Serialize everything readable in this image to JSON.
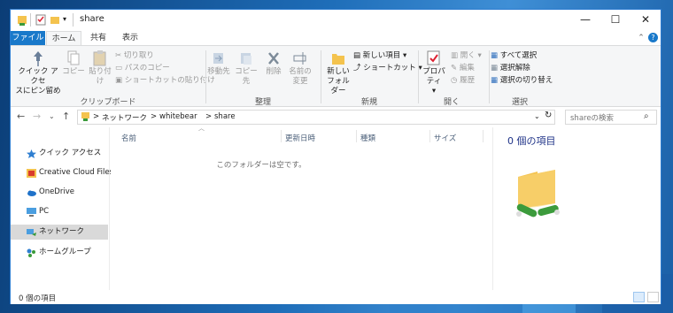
{
  "window": {
    "title": "share",
    "controls": {
      "minimize": "—",
      "maximize": "☐",
      "close": "✕"
    }
  },
  "ribbon_tabs": [
    "ファイル",
    "ホーム",
    "共有",
    "表示"
  ],
  "ribbon": {
    "clipboard": {
      "label": "クリップボード",
      "pin_line1": "クイック アクセ",
      "pin_line2": "スにピン留め",
      "copy": "コピー",
      "paste": "貼り付け",
      "cut": "切り取り",
      "copy_path": "パスのコピー",
      "paste_shortcut": "ショートカットの貼り付け"
    },
    "organize": {
      "label": "整理",
      "move_to": "移動先",
      "copy_to": "コピー先",
      "delete": "削除",
      "rename_line1": "名前の",
      "rename_line2": "変更"
    },
    "new": {
      "label": "新規",
      "new_folder_line1": "新しい",
      "new_folder_line2": "フォルダー",
      "new_item": "新しい項目",
      "shortcut": "ショートカット"
    },
    "open": {
      "label": "開く",
      "properties": "プロパティ",
      "open": "開く",
      "edit": "編集",
      "history": "履歴"
    },
    "select": {
      "label": "選択",
      "select_all": "すべて選択",
      "select_none": "選択解除",
      "invert": "選択の切り替え"
    }
  },
  "address": {
    "crumbs": [
      "ネットワーク",
      "whitebear",
      "share"
    ],
    "separator": ">",
    "search_placeholder": "shareの検索"
  },
  "nav": {
    "items": [
      {
        "label": "クイック アクセス",
        "icon": "star-icon"
      },
      {
        "label": "Creative Cloud Files",
        "icon": "creative-cloud-icon"
      },
      {
        "label": "OneDrive",
        "icon": "cloud-icon"
      },
      {
        "label": "PC",
        "icon": "pc-icon"
      },
      {
        "label": "ネットワーク",
        "icon": "network-icon",
        "selected": true
      },
      {
        "label": "ホームグループ",
        "icon": "homegroup-icon"
      }
    ]
  },
  "columns": [
    "名前",
    "更新日時",
    "種類",
    "サイズ"
  ],
  "empty_message": "このフォルダーは空です。",
  "details": {
    "title": "0 個の項目"
  },
  "status": {
    "count": "0 個の項目"
  },
  "colors": {
    "accent": "#1979ca",
    "folder": "#f4c34e",
    "selected_nav": "#d9d9d9"
  }
}
